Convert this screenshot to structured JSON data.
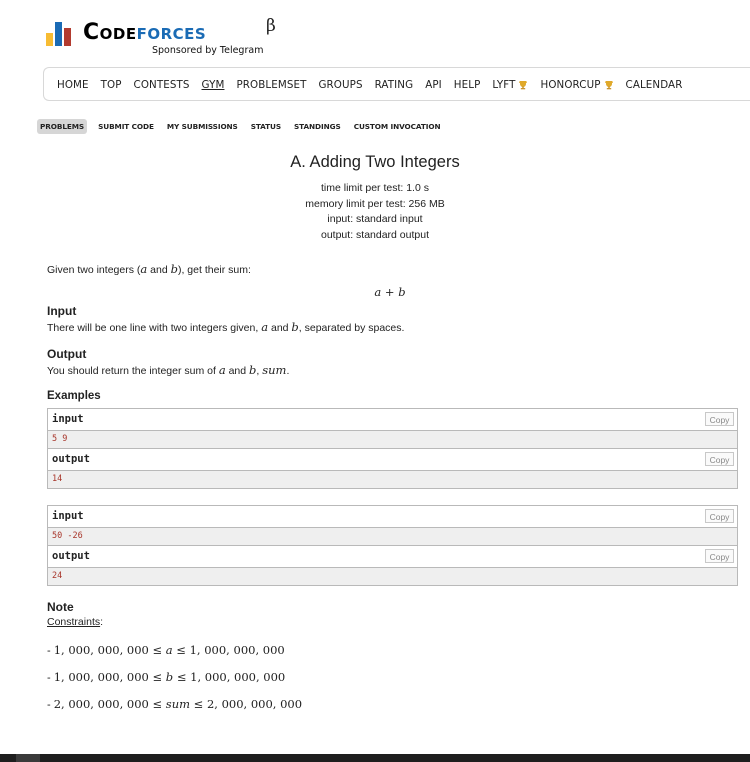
{
  "brand": {
    "word_part1": "Code",
    "word_part2": "forces",
    "beta": "β",
    "sponsor": "Sponsored by Telegram"
  },
  "menu": [
    {
      "label": "HOME",
      "active": false
    },
    {
      "label": "TOP",
      "active": false
    },
    {
      "label": "CONTESTS",
      "active": false
    },
    {
      "label": "GYM",
      "active": true
    },
    {
      "label": "PROBLEMSET",
      "active": false
    },
    {
      "label": "GROUPS",
      "active": false
    },
    {
      "label": "RATING",
      "active": false
    },
    {
      "label": "API",
      "active": false
    },
    {
      "label": "HELP",
      "active": false
    },
    {
      "label": "LYFT",
      "active": false,
      "icon": "trophy-icon"
    },
    {
      "label": "HONORCUP",
      "active": false,
      "icon": "trophy-icon"
    },
    {
      "label": "CALENDAR",
      "active": false
    }
  ],
  "submenu": [
    {
      "label": "PROBLEMS",
      "active": true
    },
    {
      "label": "SUBMIT CODE",
      "active": false
    },
    {
      "label": "MY SUBMISSIONS",
      "active": false
    },
    {
      "label": "STATUS",
      "active": false
    },
    {
      "label": "STANDINGS",
      "active": false
    },
    {
      "label": "CUSTOM INVOCATION",
      "active": false
    }
  ],
  "problem": {
    "title": "A. Adding Two Integers",
    "time_limit": "time limit per test: 1.0 s",
    "memory_limit": "memory limit per test: 256 MB",
    "input_source": "input: standard input",
    "output_source": "output: standard output",
    "legend_pre": "Given two integers (",
    "legend_a": "a",
    "legend_and": " and ",
    "legend_b": "b",
    "legend_post": "), get their sum:",
    "formula_a": "a",
    "formula_plus": " + ",
    "formula_b": "b",
    "input_title": "Input",
    "input_pre": "There will be one line with two integers given, ",
    "input_a": "a",
    "input_and": " and ",
    "input_b": "b",
    "input_post": ", separated by spaces.",
    "output_title": "Output",
    "output_pre": "You should return the integer sum of ",
    "output_a": "a",
    "output_and": " and ",
    "output_b": "b",
    "output_comma": ", ",
    "output_sum": "sum",
    "output_post": ".",
    "examples_title": "Examples",
    "note_title": "Note",
    "constraints_label": "Constraints",
    "constraints_colon": ":"
  },
  "examples": [
    {
      "input_label": "input",
      "input_value": "5 9",
      "output_label": "output",
      "output_value": "14",
      "copy_label": "Copy"
    },
    {
      "input_label": "input",
      "input_value": "50 -26",
      "output_label": "output",
      "output_value": "24",
      "copy_label": "Copy"
    }
  ],
  "constraints": [
    {
      "dash": "- ",
      "left": "1, 000, 000, 000",
      "le1": " ≤ ",
      "var": "a",
      "le2": " ≤ ",
      "right": "1, 000, 000, 000"
    },
    {
      "dash": "- ",
      "left": "1, 000, 000, 000",
      "le1": " ≤ ",
      "var": "b",
      "le2": " ≤ ",
      "right": "1, 000, 000, 000"
    },
    {
      "dash": "- ",
      "left": "2, 000, 000, 000",
      "le1": " ≤ ",
      "var": "sum",
      "le2": " ≤ ",
      "right": "2, 000, 000, 000"
    }
  ],
  "colors": {
    "logo_blue": "#1a6bb5",
    "logo_yellow": "#f7bc33",
    "logo_red": "#b23b2f",
    "sample_value": "#a8362b"
  }
}
